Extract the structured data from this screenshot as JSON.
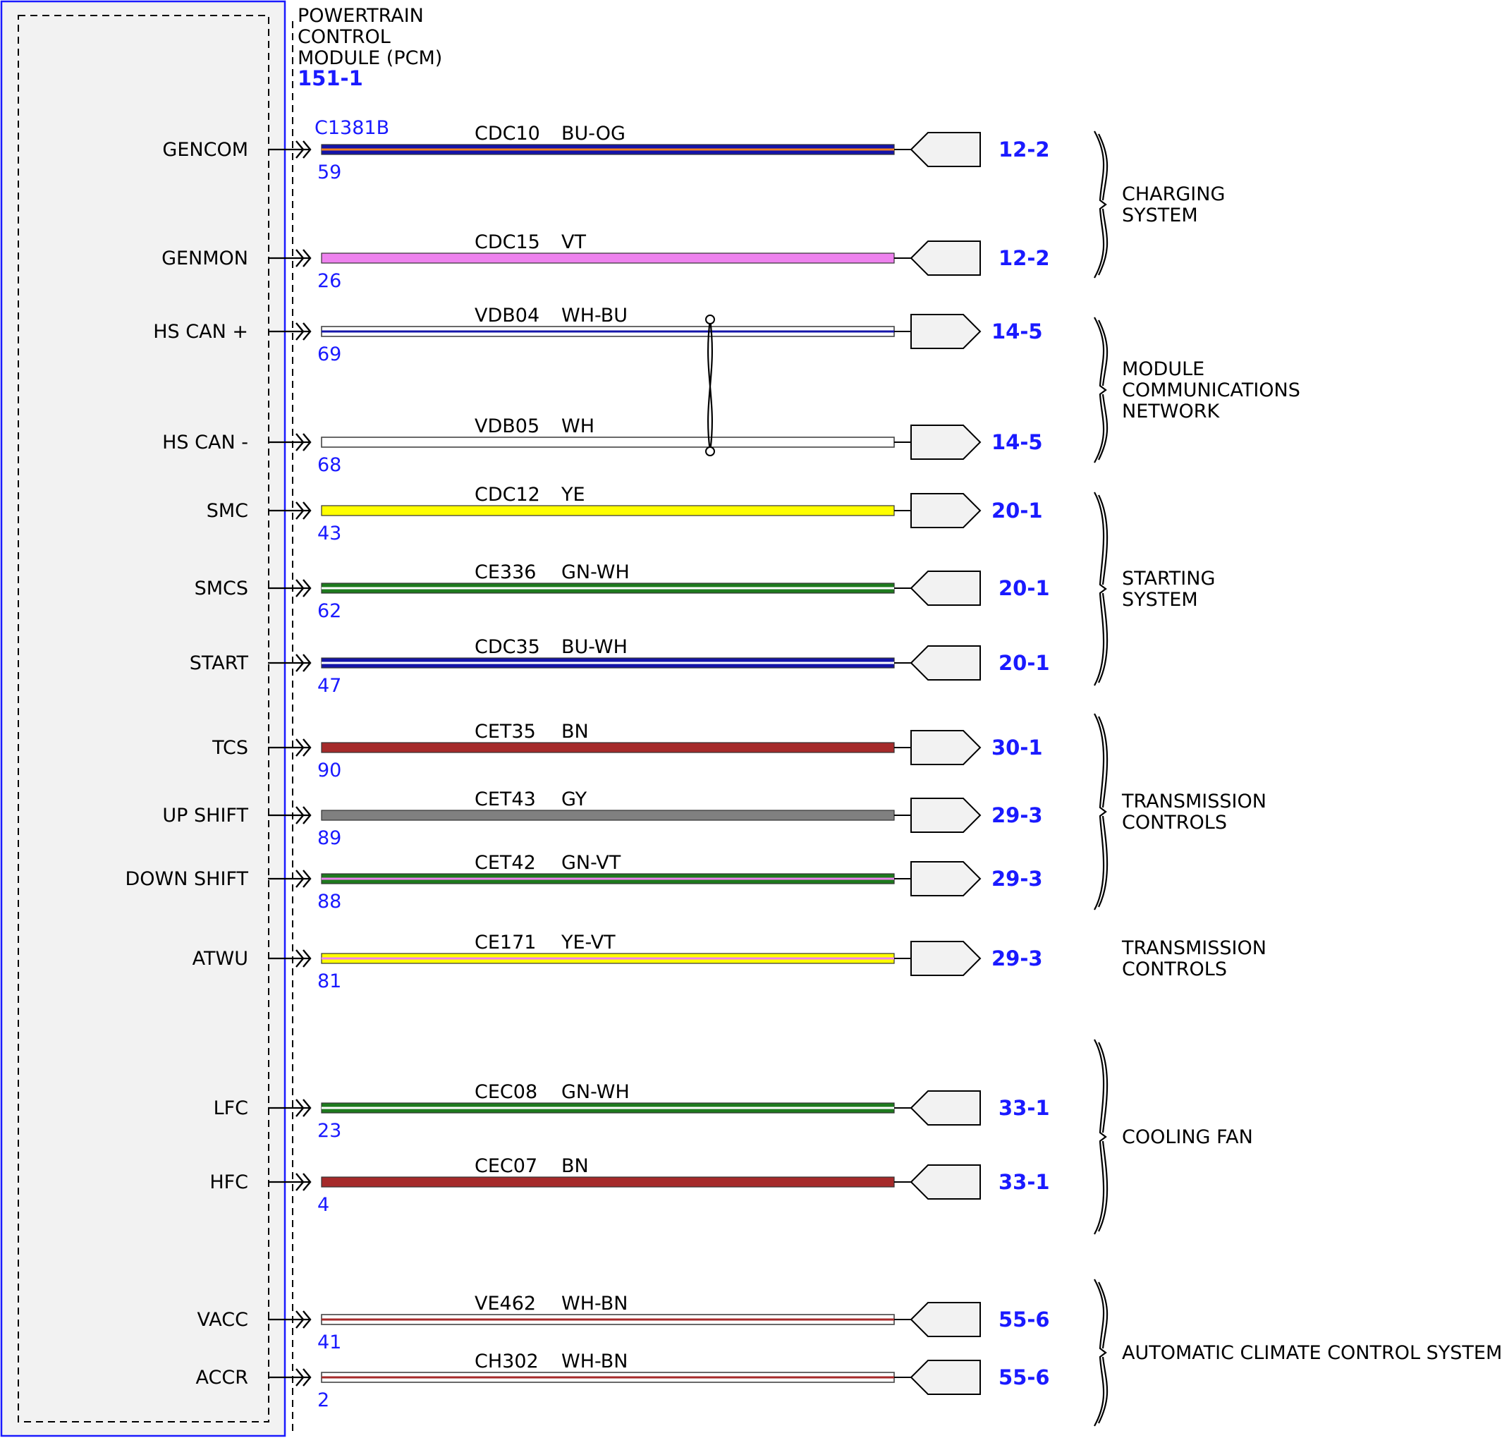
{
  "module": {
    "title_lines": [
      "POWERTRAIN",
      "CONTROL",
      "MODULE (PCM)"
    ],
    "ref": "151-1",
    "connector": "C1381B"
  },
  "colors": {
    "BU": "#1414a8",
    "OG": "#f08020",
    "VT": "#ee82ee",
    "WH": "#ffffff",
    "YE": "#ffff00",
    "GN": "#1e7a1e",
    "BN": "#a52a2a",
    "GY": "#808080",
    "border_blue": "#1a1aff",
    "module_fill": "#f2f2f2"
  },
  "circuits": [
    {
      "signal": "GENCOM",
      "pin": "59",
      "circuit": "CDC10",
      "color_code": "BU-OG",
      "base": "BU",
      "stripe": "OG",
      "dest": "12-2",
      "dir": "in"
    },
    {
      "signal": "GENMON",
      "pin": "26",
      "circuit": "CDC15",
      "color_code": "VT",
      "base": "VT",
      "stripe": null,
      "dest": "12-2",
      "dir": "in"
    },
    {
      "signal": "HS CAN +",
      "pin": "69",
      "circuit": "VDB04",
      "color_code": "WH-BU",
      "base": "WH",
      "stripe": "BU",
      "dest": "14-5",
      "dir": "out",
      "twisted": true
    },
    {
      "signal": "HS CAN -",
      "pin": "68",
      "circuit": "VDB05",
      "color_code": "WH",
      "base": "WH",
      "stripe": null,
      "dest": "14-5",
      "dir": "out",
      "twisted": true
    },
    {
      "signal": "SMC",
      "pin": "43",
      "circuit": "CDC12",
      "color_code": "YE",
      "base": "YE",
      "stripe": null,
      "dest": "20-1",
      "dir": "out"
    },
    {
      "signal": "SMCS",
      "pin": "62",
      "circuit": "CE336",
      "color_code": "GN-WH",
      "base": "GN",
      "stripe": "WH",
      "dest": "20-1",
      "dir": "in"
    },
    {
      "signal": "START",
      "pin": "47",
      "circuit": "CDC35",
      "color_code": "BU-WH",
      "base": "BU",
      "stripe": "WH",
      "dest": "20-1",
      "dir": "in"
    },
    {
      "signal": "TCS",
      "pin": "90",
      "circuit": "CET35",
      "color_code": "BN",
      "base": "BN",
      "stripe": null,
      "dest": "30-1",
      "dir": "out"
    },
    {
      "signal": "UP SHIFT",
      "pin": "89",
      "circuit": "CET43",
      "color_code": "GY",
      "base": "GY",
      "stripe": null,
      "dest": "29-3",
      "dir": "out"
    },
    {
      "signal": "DOWN SHIFT",
      "pin": "88",
      "circuit": "CET42",
      "color_code": "GN-VT",
      "base": "GN",
      "stripe": "VT",
      "dest": "29-3",
      "dir": "out"
    },
    {
      "signal": "ATWU",
      "pin": "81",
      "circuit": "CE171",
      "color_code": "YE-VT",
      "base": "YE",
      "stripe": "VT",
      "dest": "29-3",
      "dir": "out"
    },
    {
      "signal": "LFC",
      "pin": "23",
      "circuit": "CEC08",
      "color_code": "GN-WH",
      "base": "GN",
      "stripe": "WH",
      "dest": "33-1",
      "dir": "in"
    },
    {
      "signal": "HFC",
      "pin": "4",
      "circuit": "CEC07",
      "color_code": "BN",
      "base": "BN",
      "stripe": null,
      "dest": "33-1",
      "dir": "in"
    },
    {
      "signal": "VACC",
      "pin": "41",
      "circuit": "VE462",
      "color_code": "WH-BN",
      "base": "WH",
      "stripe": "BN",
      "dest": "55-6",
      "dir": "in"
    },
    {
      "signal": "ACCR",
      "pin": "2",
      "circuit": "CH302",
      "color_code": "WH-BN",
      "base": "WH",
      "stripe": "BN",
      "dest": "55-6",
      "dir": "in"
    }
  ],
  "groups": [
    {
      "lines": [
        "CHARGING",
        "SYSTEM"
      ],
      "brace": true
    },
    {
      "lines": [
        "MODULE",
        "COMMUNICATIONS",
        "NETWORK"
      ],
      "brace": true
    },
    {
      "lines": [
        "STARTING",
        "SYSTEM"
      ],
      "brace": true
    },
    {
      "lines": [
        "TRANSMISSION",
        "CONTROLS"
      ],
      "brace": true
    },
    {
      "lines": [
        "TRANSMISSION",
        "CONTROLS"
      ],
      "brace": false
    },
    {
      "lines": [
        "COOLING FAN"
      ],
      "brace": true
    },
    {
      "lines": [
        "AUTOMATIC CLIMATE CONTROL SYSTEM"
      ],
      "brace": true
    }
  ]
}
